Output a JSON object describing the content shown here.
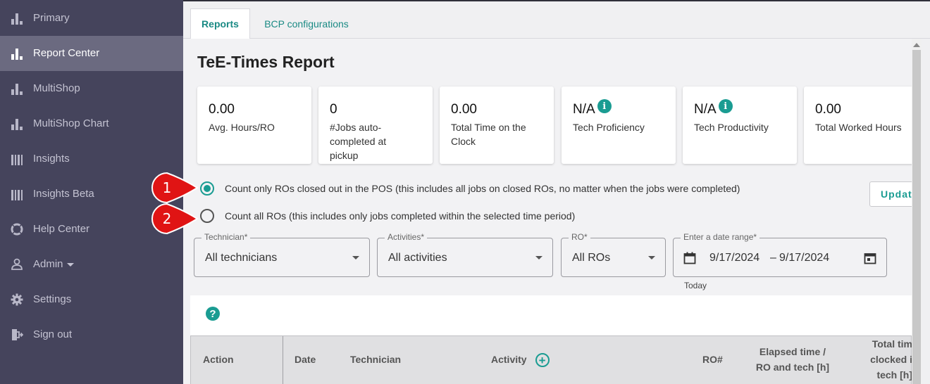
{
  "sidebar": {
    "items": [
      {
        "label": "Primary",
        "icon": "bar-chart-icon"
      },
      {
        "label": "Report Center",
        "icon": "bar-chart-icon",
        "active": true
      },
      {
        "label": "MultiShop",
        "icon": "bar-chart-icon"
      },
      {
        "label": "MultiShop Chart",
        "icon": "bar-chart-icon"
      },
      {
        "label": "Insights",
        "icon": "barcode-icon"
      },
      {
        "label": "Insights Beta",
        "icon": "barcode-icon"
      },
      {
        "label": "Help Center",
        "icon": "lifebuoy-icon"
      },
      {
        "label": "Admin",
        "icon": "user-icon"
      },
      {
        "label": "Settings",
        "icon": "gear-icon"
      },
      {
        "label": "Sign out",
        "icon": "sign-out-icon"
      }
    ]
  },
  "tabs": [
    {
      "label": "Reports",
      "active": true
    },
    {
      "label": "BCP configurations"
    }
  ],
  "page": {
    "title": "TeE-Times Report"
  },
  "cards": [
    {
      "value": "0.00",
      "caption": "Avg. Hours/RO"
    },
    {
      "value": "0",
      "caption": "#Jobs auto-completed at pickup"
    },
    {
      "value": "0.00",
      "caption": "Total Time on the Clock"
    },
    {
      "value": "N/A",
      "caption": "Tech Proficiency",
      "info": true
    },
    {
      "value": "N/A",
      "caption": "Tech Productivity",
      "info": true
    },
    {
      "value": "0.00",
      "caption": "Total Worked Hours"
    }
  ],
  "options": {
    "closed_ros": "Count only ROs closed out in the POS (this includes all jobs on closed ROs, no matter when the jobs were completed)",
    "all_ros": "Count all ROs (this includes only jobs completed within the selected time period)",
    "selected": "closed_ros"
  },
  "update_label": "Update",
  "filters": {
    "technician": {
      "label": "Technician*",
      "value": "All technicians"
    },
    "activities": {
      "label": "Activities*",
      "value": "All activities"
    },
    "ro": {
      "label": "RO*",
      "value": "All ROs"
    },
    "date": {
      "label": "Enter a date range*",
      "start": "9/17/2024",
      "separator": "–",
      "end": "9/17/2024",
      "hint": "Today"
    }
  },
  "table": {
    "columns": {
      "action": "Action",
      "date": "Date",
      "technician": "Technician",
      "activity": "Activity",
      "ro": "RO#",
      "elapsed_1": "Elapsed time /",
      "elapsed_2": "RO and tech [h]",
      "total_1": "Total tim",
      "total_2": "clocked i",
      "total_3": "tech [h]"
    }
  },
  "callouts": [
    "1",
    "2"
  ],
  "colors": {
    "accent": "#1a9c92",
    "sidebar": "#45445c",
    "callout": "#e01414"
  }
}
